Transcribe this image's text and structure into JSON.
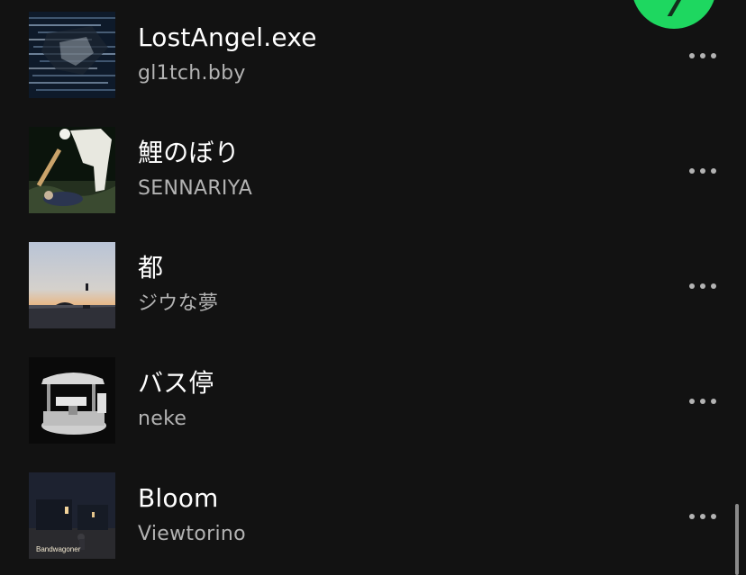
{
  "tracks": [
    {
      "title": "LostAngel.exe",
      "artist": "gl1tch.bby",
      "cover": "glitch-code-art",
      "more_icon": "more-horizontal-icon"
    },
    {
      "title": "鯉のぼり",
      "artist": "SENNARIYA",
      "cover": "night-flash-photo",
      "more_icon": "more-horizontal-icon"
    },
    {
      "title": "都",
      "artist": "ジウな夢",
      "cover": "sunset-beach-photo",
      "more_icon": "more-horizontal-icon"
    },
    {
      "title": "バス停",
      "artist": "neke",
      "cover": "bus-stop-sketch",
      "more_icon": "more-horizontal-icon"
    },
    {
      "title": "Bloom",
      "artist": "Viewtorino",
      "cover": "bandwagoner-album",
      "cover_text": "Bandwagoner",
      "more_icon": "more-horizontal-icon"
    }
  ],
  "colors": {
    "background": "#121212",
    "title": "#ffffff",
    "subtitle": "#b3b3b3",
    "accent": "#1ed760"
  },
  "controls": {
    "play_button": "play-fab",
    "scrollbar": "vertical-scrollbar"
  }
}
